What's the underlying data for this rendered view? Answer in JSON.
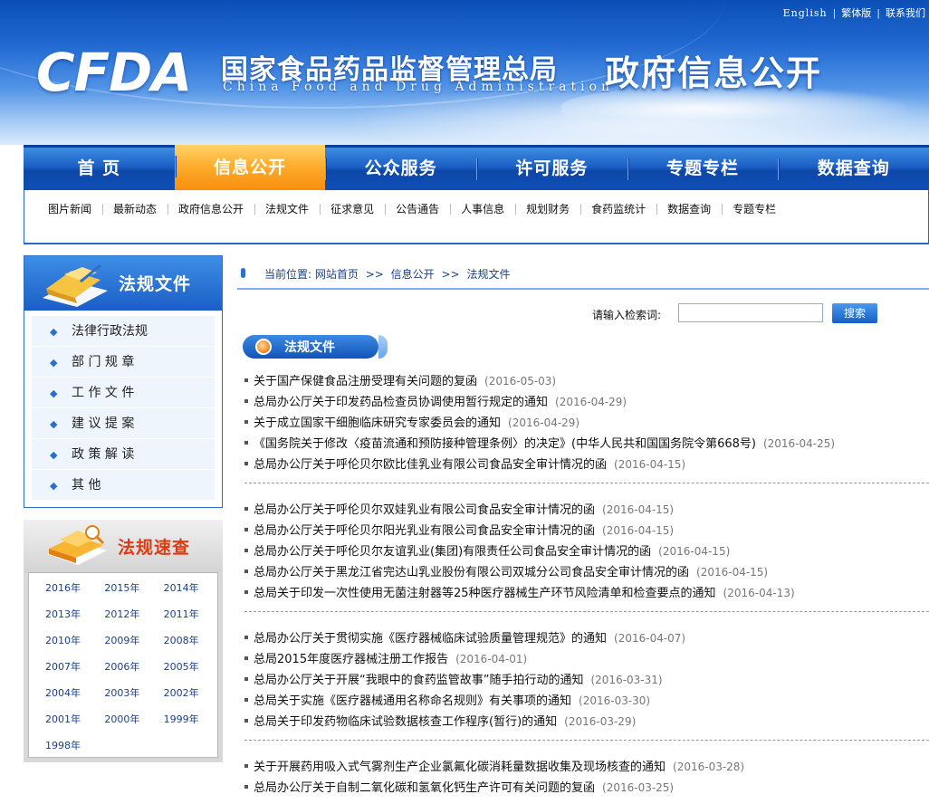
{
  "toplinks": {
    "english": "English",
    "traditional": "繁体版",
    "contact": "联系我们"
  },
  "header": {
    "logo": "CFDA",
    "org_name": "国家食品药品监督管理总局",
    "org_en": "China Food and Drug Administration",
    "site_title": "政府信息公开"
  },
  "mainnav": [
    "首 页",
    "信息公开",
    "公众服务",
    "许可服务",
    "专题专栏",
    "数据查询"
  ],
  "mainnav_active": 1,
  "subnav": [
    "图片新闻",
    "最新动态",
    "政府信息公开",
    "法规文件",
    "征求意见",
    "公告通告",
    "人事信息",
    "规划财务",
    "食药监统计",
    "数据查询",
    "专题专栏"
  ],
  "sidebar1": {
    "title": "法规文件",
    "items": [
      "法律行政法规",
      "部 门 规 章",
      "工 作 文 件",
      "建 议 提 案",
      "政 策 解 读",
      "其 他"
    ],
    "bullet": "◆"
  },
  "sidebar2": {
    "title": "法规速查",
    "years": [
      "2016年",
      "2015年",
      "2014年",
      "2013年",
      "2012年",
      "2011年",
      "2010年",
      "2009年",
      "2008年",
      "2007年",
      "2006年",
      "2005年",
      "2004年",
      "2003年",
      "2002年",
      "2001年",
      "2000年",
      "1999年",
      "1998年"
    ]
  },
  "breadcrumb": {
    "prefix": "当前位置:",
    "home": "网站首页",
    "level1": "信息公开",
    "level2": "法规文件",
    "sep": ">>"
  },
  "search": {
    "label": "请输入检索词:",
    "value": "",
    "button": "搜索"
  },
  "section": {
    "title": "法规文件"
  },
  "news_groups": [
    [
      {
        "title": "关于国产保健食品注册受理有关问题的复函",
        "date": "(2016-05-03)"
      },
      {
        "title": "总局办公厅关于印发药品检查员协调使用暂行规定的通知",
        "date": "(2016-04-29)"
      },
      {
        "title": "关于成立国家干细胞临床研究专家委员会的通知",
        "date": "(2016-04-29)"
      },
      {
        "title": "《国务院关于修改〈疫苗流通和预防接种管理条例〉的决定》(中华人民共和国国务院令第668号)",
        "date": "(2016-04-25)"
      },
      {
        "title": "总局办公厅关于呼伦贝尔欧比佳乳业有限公司食品安全审计情况的函",
        "date": "(2016-04-15)"
      }
    ],
    [
      {
        "title": "总局办公厅关于呼伦贝尔双娃乳业有限公司食品安全审计情况的函",
        "date": "(2016-04-15)"
      },
      {
        "title": "总局办公厅关于呼伦贝尔阳光乳业有限公司食品安全审计情况的函",
        "date": "(2016-04-15)"
      },
      {
        "title": "总局办公厅关于呼伦贝尔友谊乳业(集团)有限责任公司食品安全审计情况的函",
        "date": "(2016-04-15)"
      },
      {
        "title": "总局办公厅关于黑龙江省完达山乳业股份有限公司双城分公司食品安全审计情况的函",
        "date": "(2016-04-15)"
      },
      {
        "title": "总局关于印发一次性使用无菌注射器等25种医疗器械生产环节风险清单和检查要点的通知",
        "date": "(2016-04-13)"
      }
    ],
    [
      {
        "title": "总局办公厅关于贯彻实施《医疗器械临床试验质量管理规范》的通知",
        "date": "(2016-04-07)"
      },
      {
        "title": "总局2015年度医疗器械注册工作报告",
        "date": "(2016-04-01)"
      },
      {
        "title": "总局办公厅关于开展“我眼中的食药监管故事”随手拍行动的通知",
        "date": "(2016-03-31)"
      },
      {
        "title": "总局关于实施《医疗器械通用名称命名规则》有关事项的通知",
        "date": "(2016-03-30)"
      },
      {
        "title": "总局关于印发药物临床试验数据核查工作程序(暂行)的通知",
        "date": "(2016-03-29)"
      }
    ],
    [
      {
        "title": "关于开展药用吸入式气雾剂生产企业氯氟化碳消耗量数据收集及现场核查的通知",
        "date": "(2016-03-28)"
      },
      {
        "title": "总局办公厅关于自制二氧化碳和氢氧化钙生产许可有关问题的复函",
        "date": "(2016-03-25)"
      }
    ]
  ],
  "colors": {
    "brand_blue": "#1c5fc4",
    "active_orange": "#f88d0d",
    "quick_red": "#e03a10"
  }
}
